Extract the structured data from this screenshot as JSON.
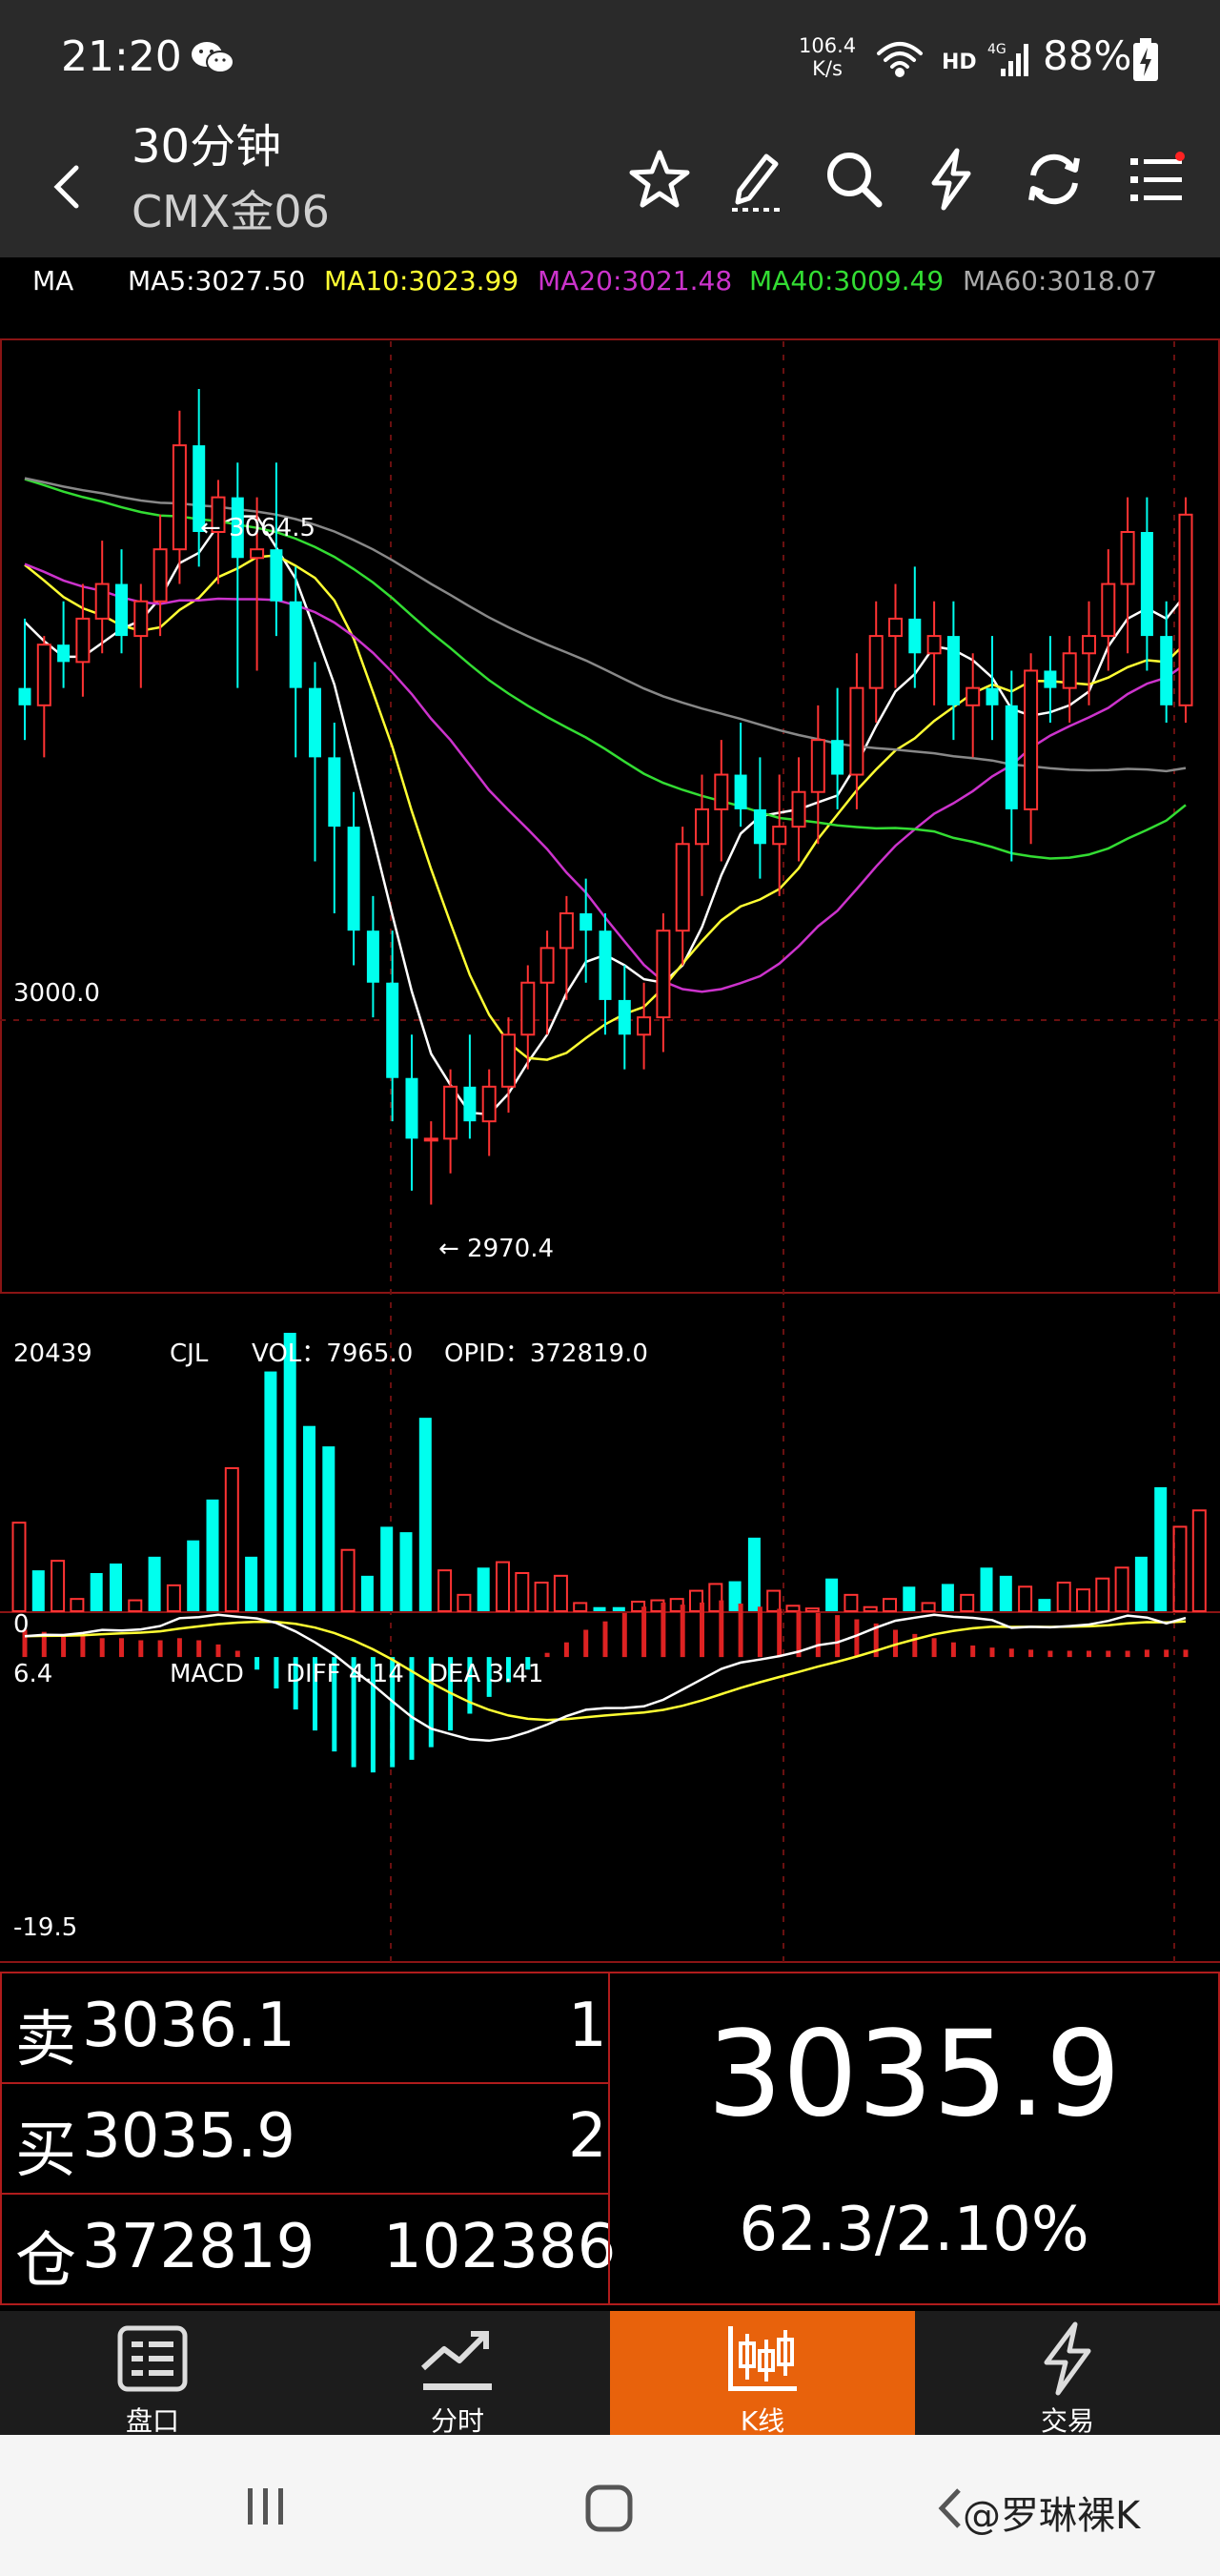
{
  "status": {
    "time": "21:20",
    "netspeed_value": "106.4",
    "netspeed_unit": "K/s",
    "hd": "HD",
    "net": "4G",
    "battery": "88%"
  },
  "header": {
    "period": "30分钟",
    "symbol": "CMX金06"
  },
  "ma": {
    "label": "MA",
    "ma5": "MA5:3027.50",
    "ma10": "MA10:3023.99",
    "ma20": "MA20:3021.48",
    "ma40": "MA40:3009.49",
    "ma60": "MA60:3018.07",
    "colors": {
      "ma5": "#ffffff",
      "ma10": "#ffff33",
      "ma20": "#cc33cc",
      "ma40": "#33dd33",
      "ma60": "#888888"
    }
  },
  "chart_labels": {
    "high": "← 3064.5",
    "low": "← 2970.4",
    "price_ref": "3000.0",
    "vol_max": "20439",
    "vol_zero": "0",
    "vol_name": "CJL",
    "vol_value": "VOL：7965.0",
    "opid_value": "OPID：372819.0",
    "macd_max": "6.4",
    "macd_min": "-19.5",
    "macd_name": "MACD",
    "diff": "DIFF 4.14",
    "dea": "DEA 3.41"
  },
  "chart_data": [
    {
      "type": "candlestick",
      "name": "price",
      "up_color": "#ff3333",
      "down_color": "#00ffee",
      "ylim": [
        2960,
        3070
      ],
      "ref_line": 3000.0,
      "high_marker": 3064.5,
      "low_marker": 2970.4,
      "candles": [
        [
          3030,
          3038,
          3024,
          3028
        ],
        [
          3028,
          3036,
          3022,
          3035
        ],
        [
          3035,
          3040,
          3030,
          3033
        ],
        [
          3033,
          3042,
          3029,
          3038
        ],
        [
          3038,
          3047,
          3034,
          3042
        ],
        [
          3042,
          3046,
          3034,
          3036
        ],
        [
          3036,
          3042,
          3030,
          3040
        ],
        [
          3040,
          3050,
          3036,
          3046
        ],
        [
          3046,
          3062,
          3042,
          3058
        ],
        [
          3058,
          3064.5,
          3044,
          3048
        ],
        [
          3048,
          3054,
          3042,
          3052
        ],
        [
          3052,
          3056,
          3030,
          3045
        ],
        [
          3045,
          3052,
          3032,
          3046
        ],
        [
          3046,
          3056,
          3036,
          3040
        ],
        [
          3040,
          3044,
          3022,
          3030
        ],
        [
          3030,
          3033,
          3010,
          3022
        ],
        [
          3022,
          3026,
          3004,
          3014
        ],
        [
          3014,
          3018,
          2998,
          3002
        ],
        [
          3002,
          3006,
          2992,
          2996
        ],
        [
          2996,
          3002,
          2980,
          2985
        ],
        [
          2985,
          2990,
          2972,
          2978
        ],
        [
          2978,
          2980,
          2970.4,
          2978
        ],
        [
          2978,
          2986,
          2974,
          2984
        ],
        [
          2984,
          2990,
          2978,
          2980
        ],
        [
          2980,
          2986,
          2976,
          2984
        ],
        [
          2984,
          2992,
          2981,
          2990
        ],
        [
          2990,
          2998,
          2986,
          2996
        ],
        [
          2996,
          3002,
          2990,
          3000
        ],
        [
          3000,
          3006,
          2994,
          3004
        ],
        [
          3004,
          3008,
          2996,
          3002
        ],
        [
          3002,
          3004,
          2990,
          2994
        ],
        [
          2994,
          2998,
          2986,
          2990
        ],
        [
          2990,
          2996,
          2986,
          2992
        ],
        [
          2992,
          3004,
          2988,
          3002
        ],
        [
          3002,
          3014,
          2998,
          3012
        ],
        [
          3012,
          3020,
          3006,
          3016
        ],
        [
          3016,
          3024,
          3010,
          3020
        ],
        [
          3020,
          3026,
          3014,
          3016
        ],
        [
          3016,
          3022,
          3008,
          3012
        ],
        [
          3012,
          3020,
          3006,
          3014
        ],
        [
          3014,
          3022,
          3010,
          3018
        ],
        [
          3018,
          3028,
          3012,
          3024
        ],
        [
          3024,
          3030,
          3016,
          3020
        ],
        [
          3020,
          3034,
          3016,
          3030
        ],
        [
          3030,
          3040,
          3026,
          3036
        ],
        [
          3036,
          3042,
          3030,
          3038
        ],
        [
          3038,
          3044,
          3030,
          3034
        ],
        [
          3034,
          3040,
          3028,
          3036
        ],
        [
          3036,
          3040,
          3024,
          3028
        ],
        [
          3028,
          3034,
          3022,
          3030
        ],
        [
          3030,
          3036,
          3024,
          3028
        ],
        [
          3028,
          3032,
          3010,
          3016
        ],
        [
          3016,
          3034,
          3012,
          3032
        ],
        [
          3032,
          3036,
          3026,
          3030
        ],
        [
          3030,
          3036,
          3026,
          3034
        ],
        [
          3034,
          3040,
          3028,
          3036
        ],
        [
          3036,
          3046,
          3032,
          3042
        ],
        [
          3042,
          3052,
          3034,
          3048
        ],
        [
          3048,
          3052,
          3032,
          3036
        ],
        [
          3036,
          3040,
          3026,
          3028
        ],
        [
          3028,
          3052,
          3026,
          3050
        ]
      ]
    },
    {
      "type": "bar",
      "name": "CJL",
      "ylim": [
        0,
        20439
      ],
      "values": [
        6500,
        3000,
        3700,
        900,
        2800,
        3500,
        800,
        4000,
        1900,
        5200,
        8200,
        10500,
        4000,
        17600,
        20439,
        13600,
        12100,
        4500,
        2600,
        6200,
        5800,
        14200,
        3000,
        1200,
        3200,
        3600,
        2800,
        2100,
        2600,
        600,
        300,
        300,
        700,
        800,
        900,
        1500,
        2000,
        2200,
        5400,
        1500,
        400,
        200,
        2400,
        1200,
        300,
        900,
        1800,
        600,
        2000,
        1200,
        3200,
        2600,
        1800,
        900,
        2100,
        1600,
        2400,
        3200,
        4000,
        9100,
        6200,
        7400
      ],
      "up": [
        1,
        0,
        1,
        1,
        0,
        0,
        1,
        0,
        1,
        0,
        0,
        1,
        0,
        0,
        0,
        0,
        0,
        1,
        0,
        0,
        0,
        0,
        1,
        1,
        0,
        1,
        1,
        1,
        1,
        1,
        0,
        0,
        1,
        1,
        1,
        1,
        1,
        0,
        0,
        1,
        1,
        1,
        0,
        1,
        1,
        1,
        0,
        1,
        0,
        1,
        0,
        0,
        1,
        0,
        1,
        1,
        1,
        1,
        0,
        0,
        1,
        1
      ]
    },
    {
      "type": "bar",
      "name": "MACD",
      "ylim": [
        -19.5,
        6.4
      ],
      "values": [
        2.6,
        2.4,
        2.2,
        2.0,
        1.8,
        1.8,
        1.6,
        1.6,
        1.8,
        1.6,
        1.2,
        0.6,
        -1.2,
        -3.0,
        -5.0,
        -7.0,
        -9.0,
        -10.5,
        -11.0,
        -10.5,
        -9.8,
        -8.6,
        -7.0,
        -5.4,
        -3.8,
        -2.4,
        -1.2,
        0.4,
        1.4,
        2.6,
        3.4,
        4.2,
        4.8,
        5.2,
        5.0,
        5.2,
        5.4,
        5.1,
        4.8,
        4.6,
        4.4,
        4.2,
        4.0,
        3.6,
        3.2,
        2.6,
        2.2,
        1.8,
        1.4,
        1.1,
        0.9,
        0.8,
        0.7,
        0.6,
        0.6,
        0.6,
        0.6,
        0.6,
        0.7,
        0.7,
        0.7
      ]
    }
  ],
  "quote": {
    "sell_label": "卖",
    "sell_price": "3036.1",
    "sell_qty": "1",
    "buy_label": "买",
    "buy_price": "3035.9",
    "buy_qty": "2",
    "oi_label": "仓",
    "oi_value": "372819",
    "volume": "102386",
    "last_price": "3035.9",
    "change": "62.3/2.10%"
  },
  "tabs": [
    {
      "label": "盘口",
      "icon": "list-icon"
    },
    {
      "label": "分时",
      "icon": "trend-icon"
    },
    {
      "label": "K线",
      "icon": "candle-icon",
      "active": true
    },
    {
      "label": "交易",
      "icon": "lightning-icon"
    }
  ],
  "watermark": "@罗琳裸K"
}
